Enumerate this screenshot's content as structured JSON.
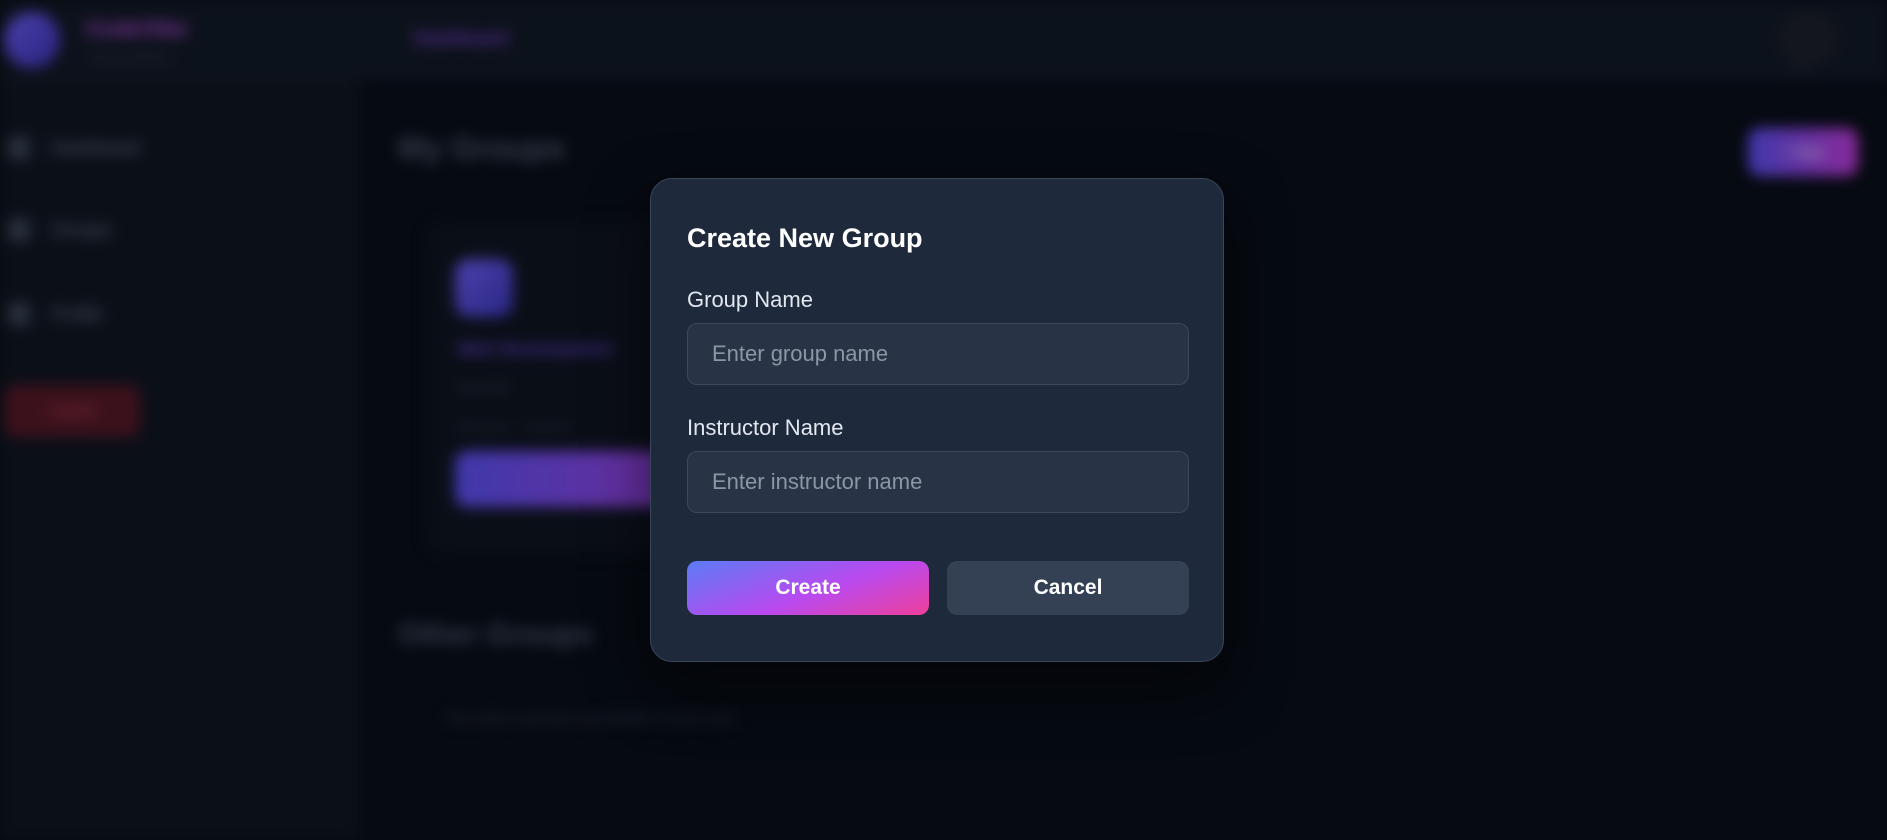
{
  "app": {
    "brand": "CodeVibe",
    "brand_sub": "learning platform",
    "nav_active": "Dashboard",
    "avatar_caption": "User"
  },
  "sidebar": {
    "items": [
      {
        "label": "Dashboard",
        "icon": "home-icon"
      },
      {
        "label": "Groups",
        "icon": "users-icon"
      },
      {
        "label": "Profile",
        "icon": "user-icon"
      }
    ],
    "logout_label": "Logout"
  },
  "main": {
    "title": "My Groups",
    "new_group_label": "+ New",
    "card": {
      "name": "Web Development",
      "instructor": "Instructor",
      "meta": "Members · Lessons",
      "button": "Open"
    },
    "other_title": "Other Groups",
    "other_empty": "No other groups available to join yet."
  },
  "modal": {
    "title": "Create New Group",
    "group_name": {
      "label": "Group Name",
      "placeholder": "Enter group name",
      "value": ""
    },
    "instructor_name": {
      "label": "Instructor Name",
      "placeholder": "Enter instructor name",
      "value": ""
    },
    "create_label": "Create",
    "cancel_label": "Cancel"
  },
  "colors": {
    "page_bg": "#080c14",
    "modal_bg": "#1e293b",
    "input_bg": "#283345",
    "cancel_bg": "#344154",
    "create_gradient": [
      "#5b7cf5",
      "#b84af0",
      "#ee3f99"
    ]
  }
}
